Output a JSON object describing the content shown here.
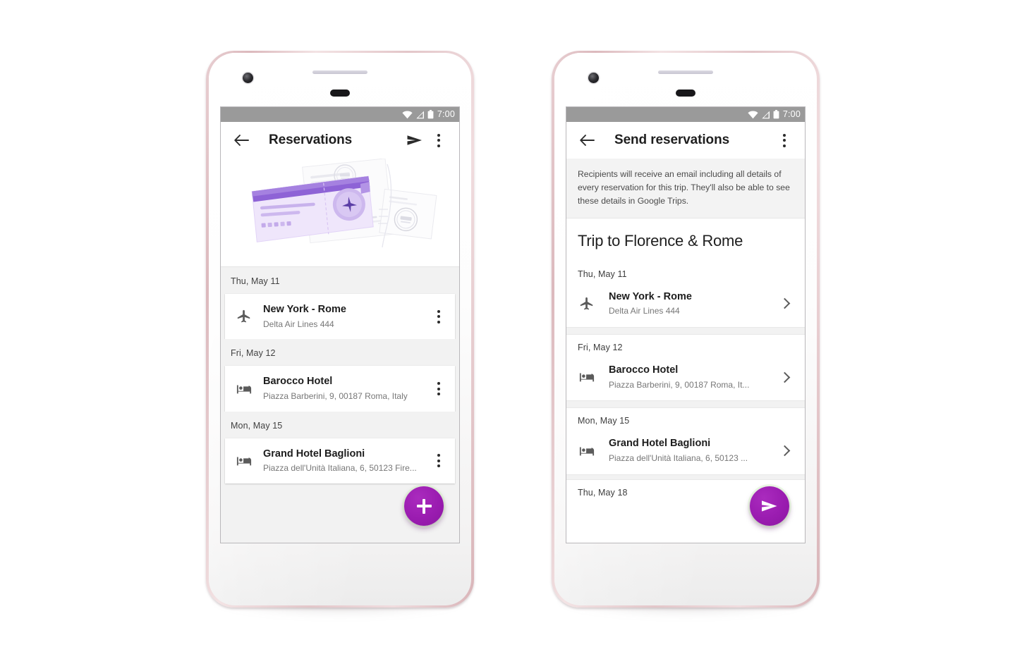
{
  "scene": {
    "background": "#ffffff",
    "accent_purple": "#9a1cb0",
    "status_bar_bg": "#9a9a9a"
  },
  "phones": [
    {
      "id": "reservations-phone",
      "status_bar": {
        "time": "7:00",
        "icons": [
          "wifi-icon",
          "cell-signal-icon",
          "battery-icon"
        ]
      },
      "app_bar": {
        "back_icon": "back-arrow-icon",
        "title": "Reservations",
        "actions": [
          "send-icon",
          "overflow-menu-icon"
        ]
      },
      "hero": {
        "illustration": "boarding-pass-illustration"
      },
      "sections": [
        {
          "date": "Thu, May 11",
          "items": [
            {
              "icon": "airplane-icon",
              "title": "New York - Rome",
              "subtitle": "Delta Air Lines 444",
              "trailing": "overflow-menu-icon"
            }
          ]
        },
        {
          "date": "Fri, May 12",
          "items": [
            {
              "icon": "hotel-bed-icon",
              "title": "Barocco Hotel",
              "subtitle": "Piazza Barberini, 9, 00187 Roma, Italy",
              "trailing": "overflow-menu-icon"
            }
          ]
        },
        {
          "date": "Mon, May 15",
          "items": [
            {
              "icon": "hotel-bed-icon",
              "title": "Grand Hotel Baglioni",
              "subtitle": "Piazza dell'Unità Italiana, 6, 50123 Fire...",
              "trailing": "overflow-menu-icon"
            }
          ]
        }
      ],
      "fab": {
        "icon": "plus-icon",
        "label": "Add reservation"
      }
    },
    {
      "id": "send-reservations-phone",
      "status_bar": {
        "time": "7:00",
        "icons": [
          "wifi-icon",
          "cell-signal-icon",
          "battery-icon"
        ]
      },
      "app_bar": {
        "back_icon": "back-arrow-icon",
        "title": "Send reservations",
        "actions": [
          "overflow-menu-icon"
        ]
      },
      "notice": "Recipients will receive an email including all details of every reservation for this trip. They'll also be able to see these details in Google Trips.",
      "trip_title": "Trip to Florence & Rome",
      "sections": [
        {
          "date": "Thu, May 11",
          "items": [
            {
              "icon": "airplane-icon",
              "title": "New York - Rome",
              "subtitle": "Delta Air Lines 444",
              "trailing": "chevron-right-icon"
            }
          ]
        },
        {
          "date": "Fri, May 12",
          "items": [
            {
              "icon": "hotel-bed-icon",
              "title": "Barocco Hotel",
              "subtitle": "Piazza Barberini, 9, 00187 Roma, It...",
              "trailing": "chevron-right-icon"
            }
          ]
        },
        {
          "date": "Mon, May 15",
          "items": [
            {
              "icon": "hotel-bed-icon",
              "title": "Grand Hotel Baglioni",
              "subtitle": "Piazza dell'Unità Italiana, 6, 50123 ...",
              "trailing": "chevron-right-icon"
            }
          ]
        },
        {
          "date": "Thu, May 18",
          "items": []
        }
      ],
      "fab": {
        "icon": "send-icon",
        "label": "Send"
      }
    }
  ]
}
